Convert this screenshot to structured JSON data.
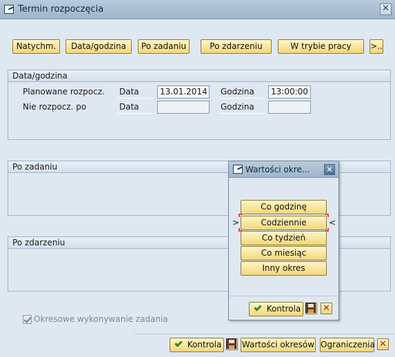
{
  "window": {
    "title": "Termin rozpoczęcia",
    "close_label": "✕"
  },
  "toolbar": {
    "buttons": [
      "Natychm.",
      "Data/godzina",
      "Po zadaniu",
      "Po zdarzeniu",
      "W trybie pracy",
      ">.."
    ]
  },
  "datetime_group": {
    "header": "Data/godzina",
    "row1": {
      "label": "Planowane rozpocz.",
      "date_label": "Data",
      "date_value": "13.01.2014",
      "time_label": "Godzina",
      "time_value": "13:00:00"
    },
    "row2": {
      "label": "Nie rozpocz. po",
      "date_label": "Data",
      "date_value": "",
      "time_label": "Godzina",
      "time_value": ""
    }
  },
  "after_job_group": {
    "header": "Po zadaniu"
  },
  "after_event_group": {
    "header": "Po zdarzeniu"
  },
  "periodic_checkbox": {
    "label": "Okresowe wykonywanie zadania",
    "checked": true,
    "enabled": false
  },
  "bottom_bar": {
    "check_label": "Kontrola",
    "period_values_label": "Wartości okresów",
    "restrictions_label": "Ograniczenia"
  },
  "popup": {
    "title": "Wartości okre...",
    "options": [
      "Co godzinę",
      "Codziennie",
      "Co tydzień",
      "Co miesiąc",
      "Inny okres"
    ],
    "selected_index": 1,
    "selected_markers": [
      ">",
      "<"
    ],
    "check_label": "Kontrola"
  },
  "colors": {
    "button_yellow": "#f2d779",
    "background": "#dfe8f1",
    "titlebar": "#9fb5cb",
    "cancel_red": "#c0161d",
    "confirm_green": "#2a8a2a"
  }
}
